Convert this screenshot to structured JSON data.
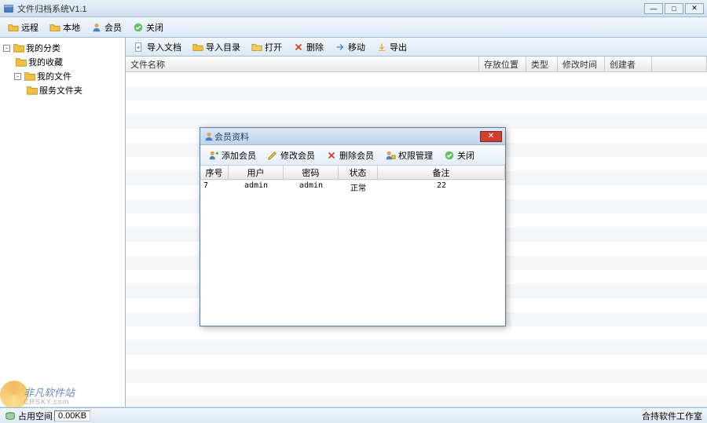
{
  "window": {
    "title": "文件归档系统V1.1"
  },
  "main_toolbar": {
    "remote": "远程",
    "local": "本地",
    "member": "会员",
    "close": "关闭"
  },
  "tree": {
    "root": "我的分类",
    "fav": "我的收藏",
    "files": "我的文件",
    "service": "服务文件夹"
  },
  "sub_toolbar": {
    "import_doc": "导入文档",
    "import_dir": "导入目录",
    "open": "打开",
    "delete": "删除",
    "move": "移动",
    "export": "导出"
  },
  "columns": {
    "filename": "文件名称",
    "location": "存放位置",
    "type": "类型",
    "modified": "修改时间",
    "creator": "创建者"
  },
  "dialog": {
    "title": "会员资料",
    "toolbar": {
      "add": "添加会员",
      "edit": "修改会员",
      "delete": "删除会员",
      "perm": "权限管理",
      "close": "关闭"
    },
    "columns": {
      "seq": "序号",
      "user": "用户",
      "pass": "密码",
      "status": "状态",
      "note": "备注"
    },
    "rows": [
      {
        "seq": "7",
        "user": "admin",
        "pass": "admin",
        "status": "正常",
        "note": "22"
      }
    ]
  },
  "statusbar": {
    "space_label": "占用空间",
    "space_value": "0.00KB",
    "studio": "合持软件工作室"
  },
  "watermark": {
    "text": "非凡软件站",
    "sub": "CRSKY.com"
  }
}
